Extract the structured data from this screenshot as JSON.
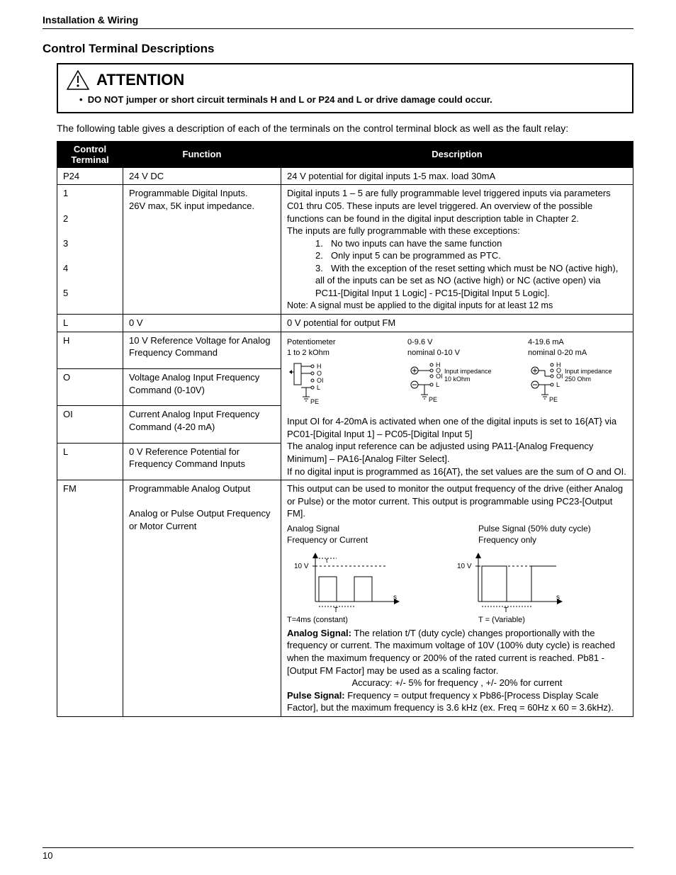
{
  "header": "Installation & Wiring",
  "section_title": "Control Terminal Descriptions",
  "attention": {
    "title": "ATTENTION",
    "bullet": "DO NOT jumper or short circuit terminals H and L or P24 and L or drive damage could occur."
  },
  "intro": "The following table gives a description of each of the terminals on the control terminal block as well as the fault relay:",
  "columns": {
    "c1": "Control Terminal",
    "c2": "Function",
    "c3": "Description"
  },
  "rows": {
    "p24": {
      "t": "P24",
      "f": "24 V DC",
      "d": "24 V potential for digital inputs 1-5 max. load 30mA"
    },
    "dig": {
      "terms": [
        "1",
        "2",
        "3",
        "4",
        "5"
      ],
      "func": "Programmable Digital Inputs.\n26V max, 5K   input impedance.",
      "d_intro": "Digital inputs 1 – 5 are fully programmable level triggered inputs via parameters C01 thru C05. These inputs are level triggered. An overview of the possible functions can be found in the digital input description table in Chapter 2.",
      "d_exc": "The inputs are fully programmable with these exceptions:",
      "items": [
        "No two inputs can have the same function",
        "Only input 5 can be programmed as PTC.",
        "With the exception of the reset setting which must be NO (active high), all of the inputs can be set as NO (active high) or NC (active open) via PC11-[Digital Input 1 Logic] - PC15-[Digital Input 5 Logic]."
      ],
      "note": "Note: A signal must be applied to the digital inputs for at least 12 ms"
    },
    "l0": {
      "t": "L",
      "f": "0 V",
      "d": "0 V potential for output FM"
    },
    "h": {
      "t": "H",
      "f": "10 V Reference Voltage for Analog Frequency Command"
    },
    "o": {
      "t": "O",
      "f": "Voltage Analog Input Frequency Command (0-10V)"
    },
    "oi": {
      "t": "OI",
      "f": "Current Analog Input Frequency Command (4-20 mA)"
    },
    "lr": {
      "t": "L",
      "f": "0 V Reference Potential for Frequency Command Inputs"
    },
    "analog_diag": {
      "c1a": "Potentiometer",
      "c1b": "1 to 2 kOhm",
      "c2a": "0-9.6 V",
      "c2b": "nominal 0-10 V",
      "c2c": "Input impedance",
      "c2d": "10 kOhm",
      "c3a": "4-19.6 mA",
      "c3b": "nominal 0-20 mA",
      "c3c": "Input impedance",
      "c3d": "250 Ohm",
      "pe": "PE",
      "lh": "H",
      "lo": "O",
      "loi": "OI",
      "ll": "L"
    },
    "analog_desc": "Input OI for 4-20mA is activated when one of the digital inputs is set to 16{AT} via PC01-[Digital Input 1] – PC05-[Digital Input 5]\nThe analog input reference can be adjusted using PA11-[Analog Frequency Minimum] – PA16-[Analog Filter Select].\nIf no digital input is programmed as 16{AT}, the set values are the sum of O and OI.",
    "fm": {
      "t": "FM",
      "f": "Programmable Analog Output\n\nAnalog or Pulse Output Frequency or Motor Current",
      "d_intro": "This output can be used to monitor the output frequency of the drive (either Analog or Pulse) or the motor current.  This output is programmable using PC23-[Output FM].",
      "sig": {
        "a_title": "Analog Signal",
        "a_sub": "Frequency or Current",
        "p_title": "Pulse Signal (50% duty cycle)",
        "p_sub": "Frequency only",
        "y": "10 V",
        "t_ax": "T",
        "s_ax": "s",
        "t_small": "t",
        "a_foot": "T=4ms (constant)",
        "p_foot": "T = (Variable)"
      },
      "d_analog_label": "Analog Signal:",
      "d_analog": "  The relation t/T (duty cycle) changes proportionally with the frequency or current.  The maximum voltage of 10V (100% duty cycle) is reached when the maximum frequency or 200% of the rated current is reached.  Pb81 - [Output FM Factor] may be used as a scaling factor.",
      "d_acc": "Accuracy:  +/- 5% for frequency , +/- 20% for current",
      "d_pulse_label": "Pulse Signal:",
      "d_pulse": "  Frequency = output frequency x Pb86-[Process Display Scale Factor], but the maximum frequency is 3.6 kHz (ex. Freq = 60Hz x 60 = 3.6kHz)."
    }
  },
  "page_number": "10"
}
